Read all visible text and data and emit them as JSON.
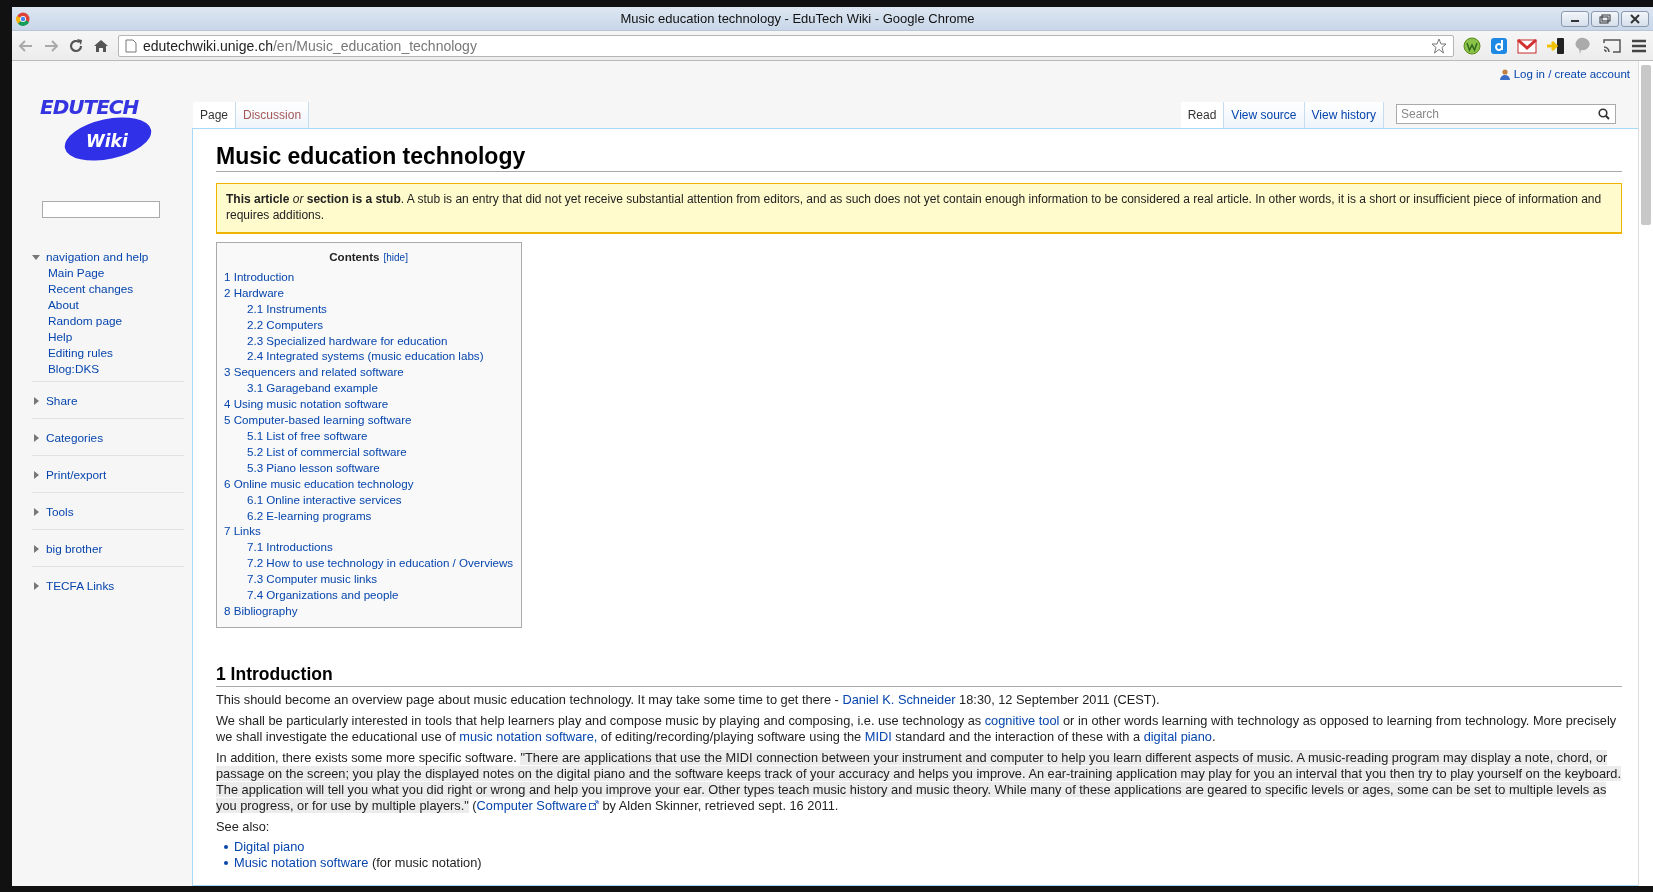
{
  "browser": {
    "title": "Music education technology - EduTech Wiki - Google Chrome",
    "url_host": "edutechwiki.unige.ch",
    "url_path": "/en/Music_education_technology"
  },
  "personal": {
    "login": "Log in / create account"
  },
  "logo": {
    "line_1": "EDUTECH",
    "line_2": "Wiki"
  },
  "sidebar": {
    "sections": [
      {
        "title": "navigation and help",
        "expanded": true,
        "items": [
          "Main Page",
          "Recent changes",
          "About",
          "Random page",
          "Help",
          "Editing rules",
          "Blog:DKS"
        ]
      },
      {
        "title": "Share",
        "expanded": false
      },
      {
        "title": "Categories",
        "expanded": false
      },
      {
        "title": "Print/export",
        "expanded": false
      },
      {
        "title": "Tools",
        "expanded": false
      },
      {
        "title": "big brother",
        "expanded": false
      },
      {
        "title": "TECFA Links",
        "expanded": false
      }
    ]
  },
  "tabs_left": [
    {
      "label": "Page",
      "selected": true,
      "missing": false
    },
    {
      "label": "Discussion",
      "selected": false,
      "missing": true
    }
  ],
  "tabs_right": [
    {
      "label": "Read",
      "selected": true
    },
    {
      "label": "View source",
      "selected": false
    },
    {
      "label": "View history",
      "selected": false
    }
  ],
  "search": {
    "placeholder": "Search"
  },
  "article": {
    "title": "Music education technology",
    "notice": "**This article** *or* **section is a stub**. A stub is an entry that did not yet receive substantial attention from editors, and as such does not yet contain enough information to be considered a real article. In other words, it is a short or insufficient piece of information and requires additions.",
    "toc": {
      "title": "Contents",
      "toggle": "[hide]",
      "items": [
        {
          "label": "1 Introduction"
        },
        {
          "label": "2 Hardware",
          "children": [
            {
              "label": "2.1 Instruments"
            },
            {
              "label": "2.2 Computers"
            },
            {
              "label": "2.3 Specialized hardware for education"
            },
            {
              "label": "2.4 Integrated systems (music education labs)"
            }
          ]
        },
        {
          "label": "3 Sequencers and related software",
          "children": [
            {
              "label": "3.1 Garageband example"
            }
          ]
        },
        {
          "label": "4 Using music notation software"
        },
        {
          "label": "5 Computer-based learning software",
          "children": [
            {
              "label": "5.1 List of free software"
            },
            {
              "label": "5.2 List of commercial software"
            },
            {
              "label": "5.3 Piano lesson software"
            }
          ]
        },
        {
          "label": "6 Online music education technology",
          "children": [
            {
              "label": "6.1 Online interactive services"
            },
            {
              "label": "6.2 E-learning programs"
            }
          ]
        },
        {
          "label": "7 Links",
          "children": [
            {
              "label": "7.1 Introductions"
            },
            {
              "label": "7.2 How to use technology in education / Overviews"
            },
            {
              "label": "7.3 Computer music links"
            },
            {
              "label": "7.4 Organizations and people"
            }
          ]
        },
        {
          "label": "8 Bibliography"
        }
      ]
    },
    "sections": [
      {
        "heading": "1 Introduction",
        "blocks": [
          {
            "kind": "paragraph",
            "segments": [
              {
                "kind": "text",
                "text": "This should become an overview page about music education technology. It may take some time to get there - "
              },
              {
                "kind": "link",
                "text": "Daniel K. Schneider"
              },
              {
                "kind": "text",
                "text": " 18:30, 12 September 2011 (CEST)."
              }
            ]
          },
          {
            "kind": "paragraph",
            "segments": [
              {
                "kind": "text",
                "text": "We shall be particularly interested in tools that help learners play and compose music by playing and composing, i.e. use technology as "
              },
              {
                "kind": "link",
                "text": "cognitive tool"
              },
              {
                "kind": "text",
                "text": " or in other words learning with technology as opposed to learning from technology. More precisely we shall investigate the educational use of "
              },
              {
                "kind": "link",
                "text": "music notation software,"
              },
              {
                "kind": "text",
                "text": " of editing/recording/playing software using the "
              },
              {
                "kind": "link",
                "text": "MIDI"
              },
              {
                "kind": "text",
                "text": " standard and the interaction of these with a "
              },
              {
                "kind": "link",
                "text": "digital piano"
              },
              {
                "kind": "text",
                "text": "."
              }
            ]
          },
          {
            "kind": "paragraph",
            "segments": [
              {
                "kind": "text",
                "text": "In addition, there exists some more specific software. "
              },
              {
                "kind": "quote",
                "text": "\"There are applications that use the MIDI connection between your instrument and computer to help you learn different aspects of music. A music-reading program may display a note, chord, or passage on the screen; you play the displayed notes on the digital piano and the software keeps track of your accuracy and helps you improve. An ear-training application may play for you an interval that you then try to play yourself on the keyboard. The application will tell you what you did right or wrong and help you improve your ear. Other types teach music history and music theory. While many of these applications are geared to specific levels or ages, some can be set to multiple levels as you progress, or for use by multiple players.\""
              },
              {
                "kind": "text",
                "text": " ("
              },
              {
                "kind": "extlink",
                "text": "Computer Software"
              },
              {
                "kind": "text",
                "text": " by Alden Skinner, retrieved sept. 16 2011."
              }
            ]
          },
          {
            "kind": "paragraph",
            "segments": [
              {
                "kind": "text",
                "text": "See also:"
              }
            ]
          },
          {
            "kind": "list",
            "items": [
              [
                {
                  "kind": "link",
                  "text": "Digital piano"
                }
              ],
              [
                {
                  "kind": "link",
                  "text": "Music notation software"
                },
                {
                  "kind": "text",
                  "text": " (for music notation)"
                }
              ]
            ]
          }
        ]
      }
    ]
  }
}
